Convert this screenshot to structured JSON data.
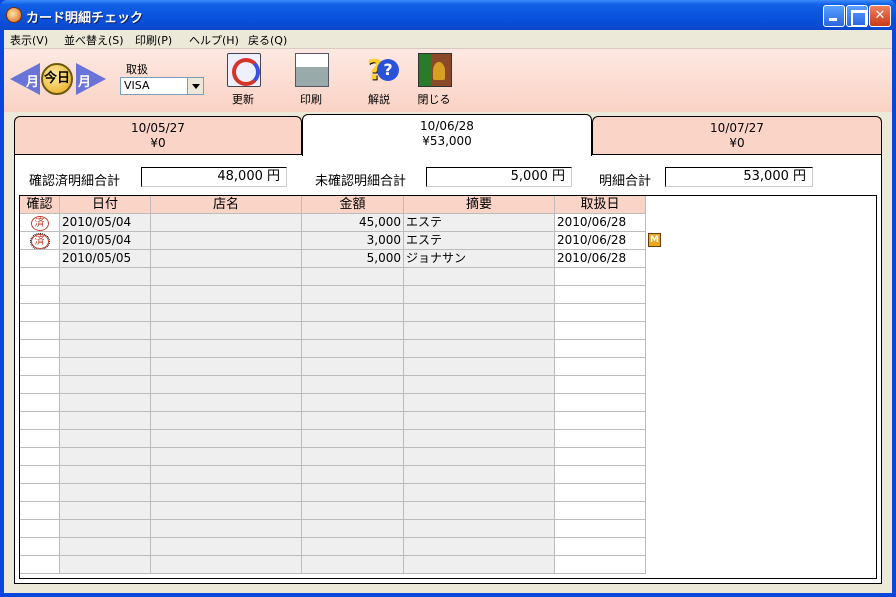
{
  "window": {
    "title": "カード明細チェック"
  },
  "menu": [
    {
      "label": "表示(V)"
    },
    {
      "label": "並べ替え(S)"
    },
    {
      "label": "印刷(P)"
    },
    {
      "label": "ヘルプ(H)"
    },
    {
      "label": "戻る(Q)"
    }
  ],
  "toolbar": {
    "prev_label": "月",
    "today_label": "今日",
    "next_label": "月",
    "card_type_label": "取扱",
    "card_type_value": "VISA",
    "refresh_label": "更新",
    "print_label": "印刷",
    "help_label": "解説",
    "close_label": "閉じる"
  },
  "tabs": [
    {
      "date": "10/05/27",
      "amount": "¥0"
    },
    {
      "date": "10/06/28",
      "amount": "¥53,000",
      "active": true
    },
    {
      "date": "10/07/27",
      "amount": "¥0"
    }
  ],
  "summary": {
    "confirmed_label": "確認済明細合計",
    "confirmed_value": "48,000 円",
    "unconfirmed_label": "未確認明細合計",
    "unconfirmed_value": "5,000 円",
    "total_label": "明細合計",
    "total_value": "53,000 円"
  },
  "table": {
    "columns": [
      "確認",
      "日付",
      "店名",
      "金額",
      "摘要",
      "取扱日"
    ],
    "rows": [
      {
        "check": "済",
        "date": "2010/05/04",
        "shop": "",
        "amount": "45,000",
        "memo": "エステ",
        "handled": "2010/06/28"
      },
      {
        "check": "済",
        "date": "2010/05/04",
        "shop": "",
        "amount": "3,000",
        "memo": "エステ",
        "handled": "2010/06/28",
        "note": "M"
      },
      {
        "check": "",
        "date": "2010/05/05",
        "shop": "",
        "amount": "5,000",
        "memo": "ジョナサン",
        "handled": "2010/06/28"
      }
    ]
  }
}
